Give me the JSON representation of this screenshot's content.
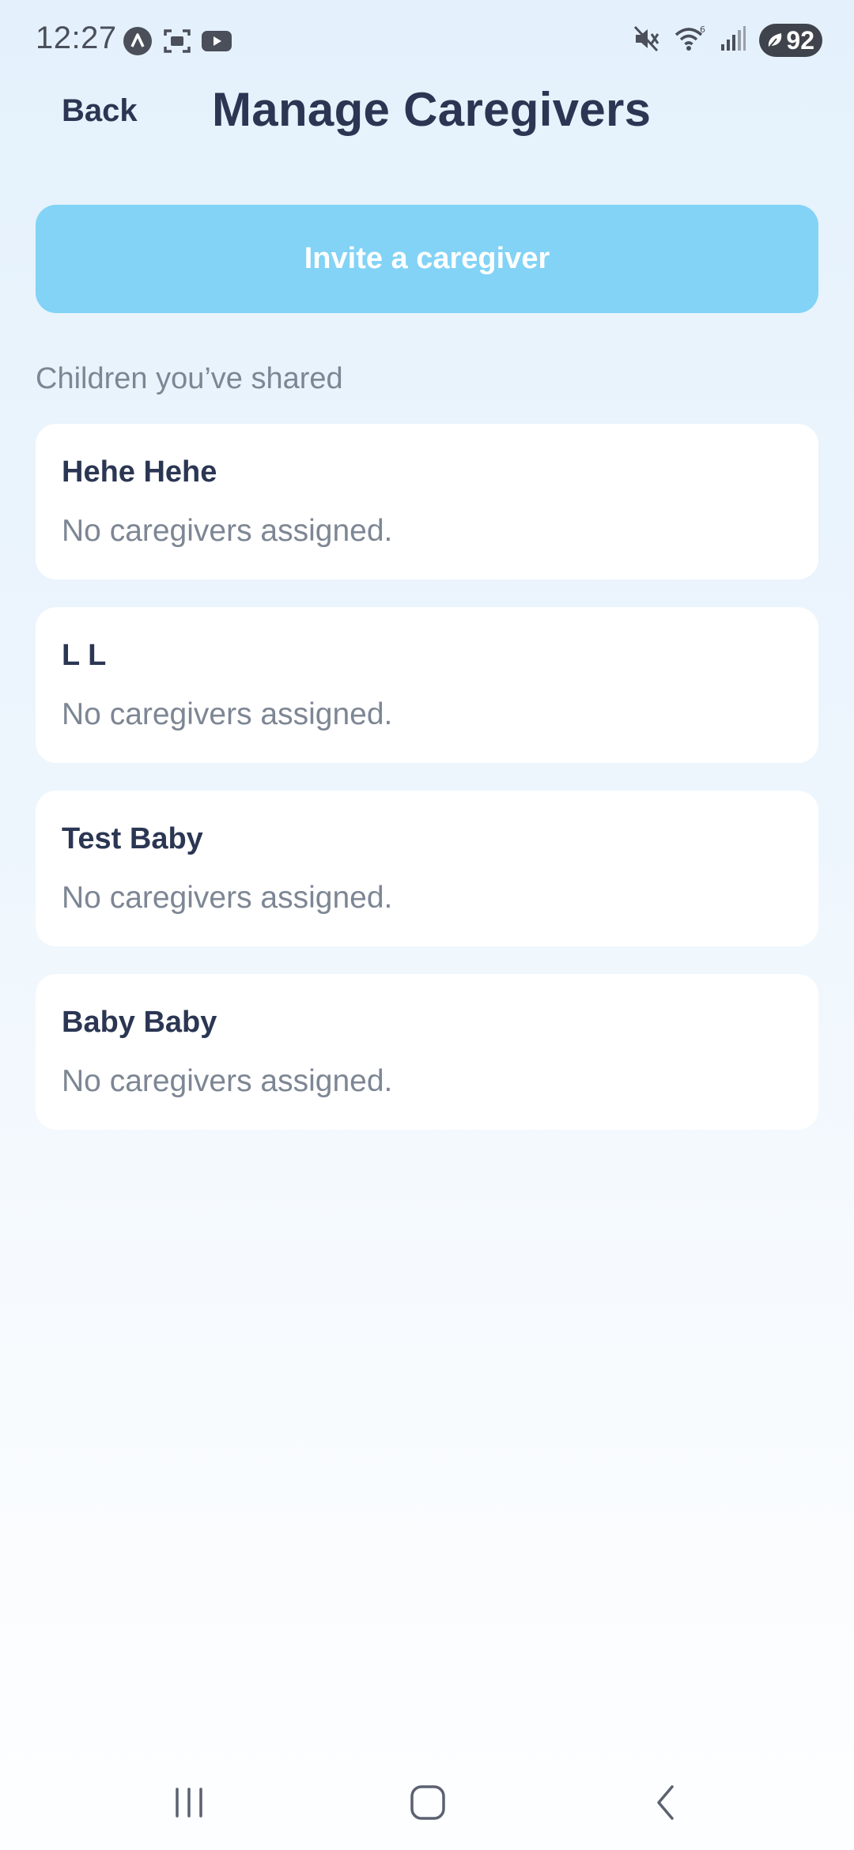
{
  "status_bar": {
    "time": "12:27",
    "battery": "92",
    "left_icons": [
      "nav-a-icon",
      "screenshot-icon",
      "youtube-icon"
    ],
    "right_icons": [
      "mute-icon",
      "wifi-icon",
      "signal-icon",
      "battery-icon"
    ]
  },
  "header": {
    "back_label": "Back",
    "title": "Manage Caregivers"
  },
  "invite_button": {
    "label": "Invite a caregiver",
    "color": "#82d3f6"
  },
  "section": {
    "label": "Children you’ve shared"
  },
  "children": [
    {
      "name": "Hehe Hehe",
      "status": "No caregivers assigned."
    },
    {
      "name": "L L",
      "status": "No caregivers assigned."
    },
    {
      "name": "Test Baby",
      "status": "No caregivers assigned."
    },
    {
      "name": "Baby Baby",
      "status": "No caregivers assigned."
    }
  ],
  "nav_bar": {
    "icons": [
      "recent-apps-icon",
      "home-icon",
      "back-icon"
    ]
  },
  "colors": {
    "text_primary": "#2b3653",
    "text_secondary": "#7d8694",
    "card_background": "#ffffff",
    "page_background_top": "#e4f1fc"
  }
}
